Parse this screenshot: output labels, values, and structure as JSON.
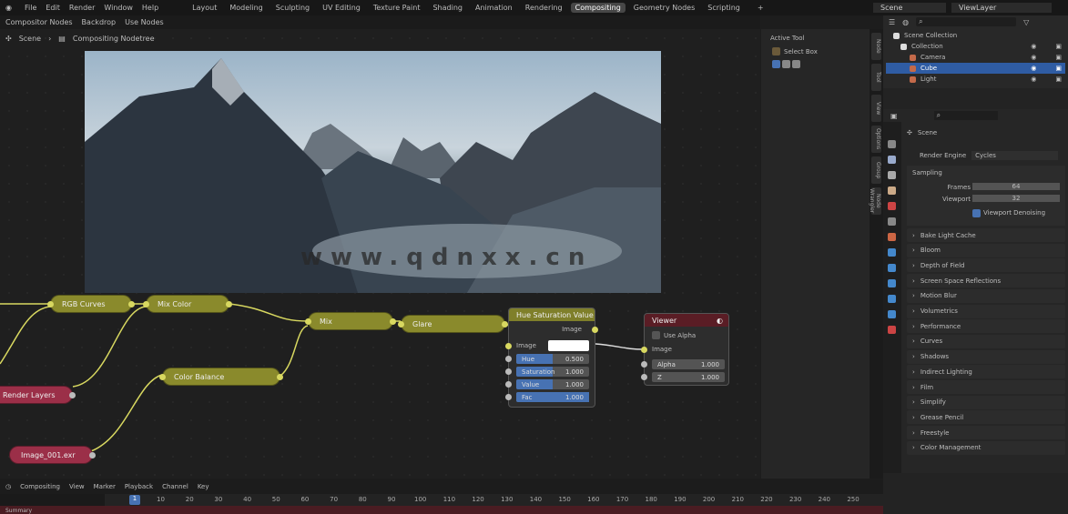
{
  "topbar": {
    "menus": [
      "File",
      "Edit",
      "Render",
      "Window",
      "Help"
    ],
    "workspaces": [
      "Layout",
      "Modeling",
      "Sculpting",
      "UV Editing",
      "Texture Paint",
      "Shading",
      "Animation",
      "Rendering",
      "Compositing",
      "Geometry Nodes",
      "Scripting"
    ],
    "active_workspace": "Compositing",
    "add_tab": "+",
    "scene": "Scene",
    "view_layer": "ViewLayer"
  },
  "header2": {
    "items": [
      "Compositor Nodes",
      "Backdrop",
      "Use Nodes"
    ]
  },
  "breadcrumb": {
    "scene": "Scene",
    "tree": "Compositing Nodetree"
  },
  "watermark": "www.qdnxx.cn",
  "nodes": {
    "small": [
      {
        "label": "RGB Curves",
        "color": "olive"
      },
      {
        "label": "Mix Color",
        "color": "olive"
      },
      {
        "label": "Mix",
        "color": "olive"
      },
      {
        "label": "Glare",
        "color": "olive"
      },
      {
        "label": "Color Balance",
        "color": "olive"
      },
      {
        "label": "Render Layers",
        "color": "red"
      },
      {
        "label": "Image_001.exr",
        "color": "red"
      }
    ],
    "hsv": {
      "title": "Hue Saturation Value",
      "output": "Image",
      "input": "Image",
      "fields": [
        {
          "label": "Hue",
          "value": "0.500",
          "fill": 0.5
        },
        {
          "label": "Saturation",
          "value": "1.000",
          "fill": 0.5
        },
        {
          "label": "Value",
          "value": "1.000",
          "fill": 0.5
        },
        {
          "label": "Fac",
          "value": "1.000",
          "fill": 1.0
        }
      ]
    },
    "viewer": {
      "title": "Viewer",
      "use_alpha": "Use Alpha",
      "image": "Image",
      "fields": [
        {
          "label": "Alpha",
          "value": "1.000"
        },
        {
          "label": "Z",
          "value": "1.000"
        }
      ]
    }
  },
  "npanel": {
    "title": "Active Tool",
    "tool": "Select Box"
  },
  "vtabs": [
    "Node",
    "Tool",
    "View",
    "Options",
    "Group",
    "Node Wrangler"
  ],
  "outliner": {
    "rows": [
      {
        "label": "Scene Collection"
      },
      {
        "label": "Collection"
      },
      {
        "label": "Camera"
      },
      {
        "label": "Cube",
        "selected": true
      },
      {
        "label": "Light"
      }
    ]
  },
  "properties": {
    "title": "Scene",
    "render_engine_label": "Render Engine",
    "render_engine": "Cycles",
    "sampling": "Sampling",
    "frames_label": "Frames",
    "frames": "64",
    "viewport_label": "Viewport",
    "viewport": "32",
    "denoise": "Viewport Denoising",
    "panels": [
      "Bake Light Cache",
      "Bloom",
      "Depth of Field",
      "Screen Space Reflections",
      "Motion Blur",
      "Volumetrics",
      "Performance",
      "Curves",
      "Shadows",
      "Indirect Lighting",
      "Film",
      "Simplify",
      "Grease Pencil",
      "Freestyle",
      "Color Management"
    ]
  },
  "timeline": {
    "mode": "Compositing",
    "menus": [
      "View",
      "Marker",
      "Playback",
      "Channel",
      "Key"
    ],
    "frame_label": "Playhead",
    "current_frame": "1",
    "ticks": [
      "10",
      "20",
      "30",
      "40",
      "50",
      "60",
      "70",
      "80",
      "90",
      "100",
      "110",
      "120",
      "130",
      "140",
      "150",
      "160",
      "170",
      "180",
      "190",
      "200",
      "210",
      "220",
      "230",
      "240",
      "250"
    ],
    "channel": "Summary"
  },
  "colors": {
    "accent": "#4772b3",
    "node_olive": "#8a8a2c",
    "node_red": "#9b2f48",
    "socket": "#d8d860"
  }
}
